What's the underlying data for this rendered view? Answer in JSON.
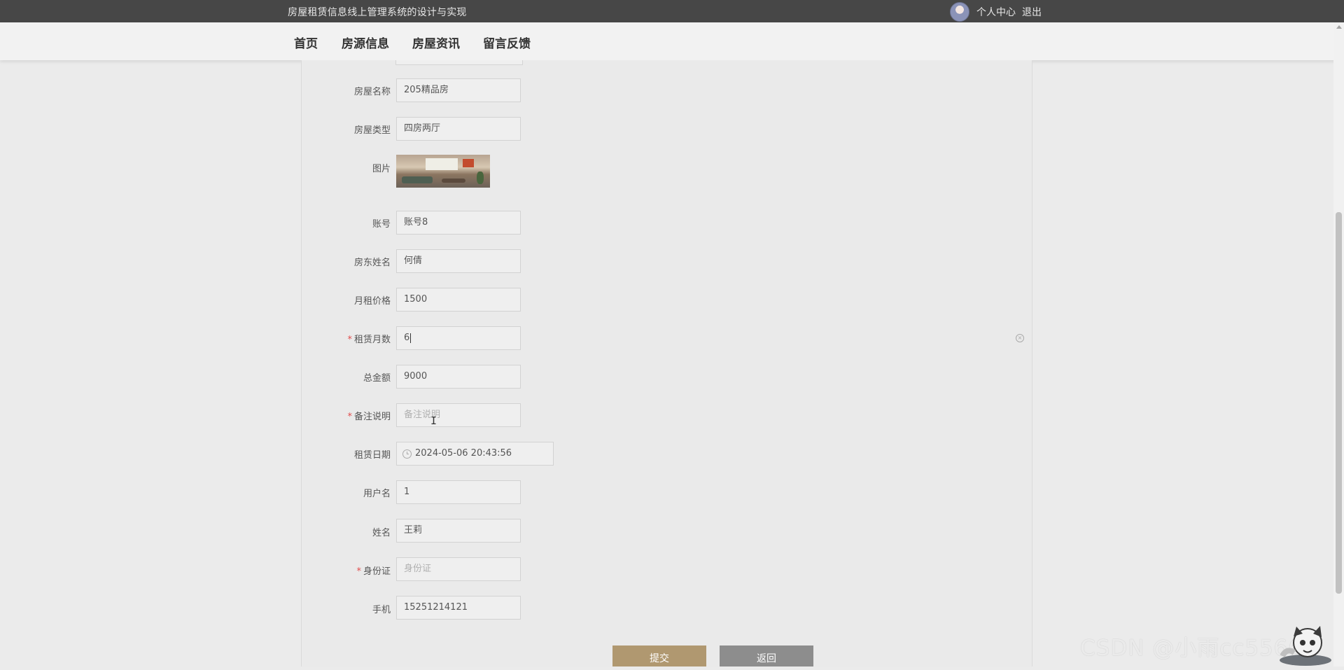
{
  "header": {
    "site_title": "房屋租赁信息线上管理系统的设计与实现",
    "user_center": "个人中心",
    "logout": "退出"
  },
  "nav": {
    "items": [
      "首页",
      "房源信息",
      "房屋资讯",
      "留言反馈"
    ]
  },
  "form": {
    "house_name": {
      "label": "房屋名称",
      "value": "205精品房"
    },
    "house_type": {
      "label": "房屋类型",
      "value": "四房两厅"
    },
    "image": {
      "label": "图片"
    },
    "account": {
      "label": "账号",
      "value": "账号8"
    },
    "landlord_name": {
      "label": "房东姓名",
      "value": "何倩"
    },
    "monthly_rent": {
      "label": "月租价格",
      "value": "1500"
    },
    "rent_months": {
      "label": "租赁月数",
      "value": "6",
      "required": true
    },
    "total_amount": {
      "label": "总金额",
      "value": "9000"
    },
    "remarks": {
      "label": "备注说明",
      "placeholder": "备注说明",
      "required": true
    },
    "rent_date": {
      "label": "租赁日期",
      "value": "2024-05-06 20:43:56"
    },
    "username": {
      "label": "用户名",
      "value": "1"
    },
    "name": {
      "label": "姓名",
      "value": "王莉"
    },
    "id_card": {
      "label": "身份证",
      "placeholder": "身份证",
      "required": true
    },
    "phone": {
      "label": "手机",
      "value": "15251214121"
    }
  },
  "buttons": {
    "submit": "提交",
    "back": "返回"
  },
  "watermark": "CSDN @小雨cc5566",
  "colors": {
    "topbar": "#474747",
    "submit": "#b09870",
    "back": "#8d8d8d",
    "required": "#e24d4d"
  }
}
